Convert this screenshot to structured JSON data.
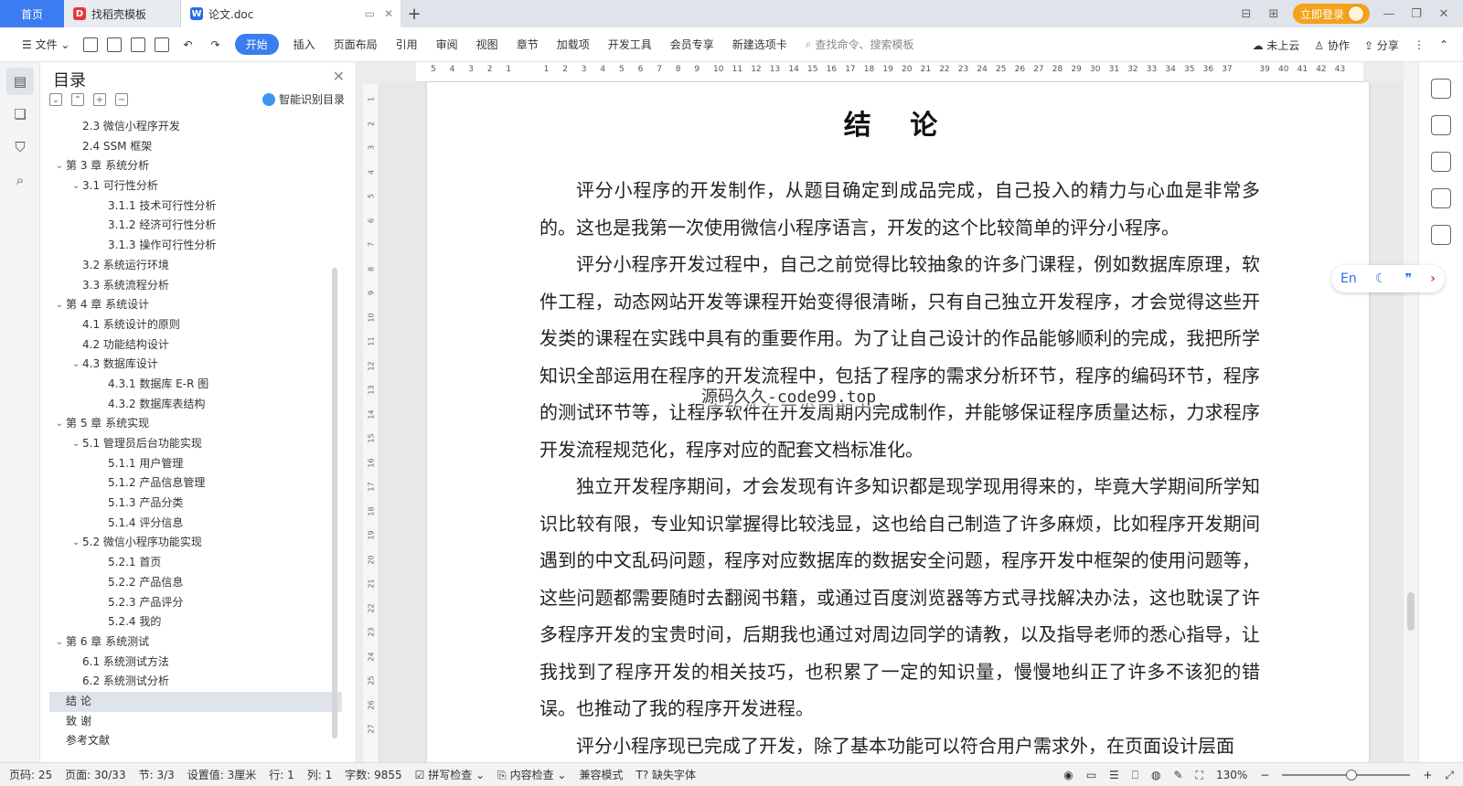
{
  "tabs": {
    "home": "首页",
    "templates": "找稻壳模板",
    "document": "论文.doc"
  },
  "header_right": {
    "login": "立即登录"
  },
  "toolbar": {
    "file": "文件",
    "items": [
      "开始",
      "插入",
      "页面布局",
      "引用",
      "审阅",
      "视图",
      "章节",
      "加载项",
      "开发工具",
      "会员专享",
      "新建选项卡"
    ],
    "search_placeholder": "查找命令、搜索模板",
    "cloud": "未上云",
    "collab": "协作",
    "share": "分享"
  },
  "toc": {
    "title": "目录",
    "smart": "智能识别目录",
    "items": [
      {
        "text": "2.3 微信小程序开发",
        "level": 2,
        "caret": ""
      },
      {
        "text": "2.4 SSM 框架",
        "level": 2,
        "caret": ""
      },
      {
        "text": "第 3 章  系统分析",
        "level": 1,
        "caret": "⌄"
      },
      {
        "text": "3.1 可行性分析",
        "level": 2,
        "caret": "⌄"
      },
      {
        "text": "3.1.1 技术可行性分析",
        "level": 3,
        "caret": ""
      },
      {
        "text": "3.1.2 经济可行性分析",
        "level": 3,
        "caret": ""
      },
      {
        "text": "3.1.3 操作可行性分析",
        "level": 3,
        "caret": ""
      },
      {
        "text": "3.2 系统运行环境",
        "level": 2,
        "caret": ""
      },
      {
        "text": "3.3 系统流程分析",
        "level": 2,
        "caret": ""
      },
      {
        "text": "第 4 章  系统设计",
        "level": 1,
        "caret": "⌄"
      },
      {
        "text": "4.1  系统设计的原则",
        "level": 2,
        "caret": ""
      },
      {
        "text": "4.2  功能结构设计",
        "level": 2,
        "caret": ""
      },
      {
        "text": "4.3  数据库设计",
        "level": 2,
        "caret": "⌄"
      },
      {
        "text": "4.3.1  数据库 E-R 图",
        "level": 3,
        "caret": ""
      },
      {
        "text": "4.3.2  数据库表结构",
        "level": 3,
        "caret": ""
      },
      {
        "text": "第 5 章  系统实现",
        "level": 1,
        "caret": "⌄"
      },
      {
        "text": "5.1 管理员后台功能实现",
        "level": 2,
        "caret": "⌄"
      },
      {
        "text": "5.1.1  用户管理",
        "level": 3,
        "caret": ""
      },
      {
        "text": "5.1.2  产品信息管理",
        "level": 3,
        "caret": ""
      },
      {
        "text": "5.1.3  产品分类",
        "level": 3,
        "caret": ""
      },
      {
        "text": "5.1.4  评分信息",
        "level": 3,
        "caret": ""
      },
      {
        "text": "5.2  微信小程序功能实现",
        "level": 2,
        "caret": "⌄"
      },
      {
        "text": "5.2.1  首页",
        "level": 3,
        "caret": ""
      },
      {
        "text": "5.2.2  产品信息",
        "level": 3,
        "caret": ""
      },
      {
        "text": "5.2.3  产品评分",
        "level": 3,
        "caret": ""
      },
      {
        "text": "5.2.4  我的",
        "level": 3,
        "caret": ""
      },
      {
        "text": "第 6 章  系统测试",
        "level": 1,
        "caret": "⌄"
      },
      {
        "text": "6.1 系统测试方法",
        "level": 2,
        "caret": ""
      },
      {
        "text": "6.2  系统测试分析",
        "level": 2,
        "caret": ""
      },
      {
        "text": "结    论",
        "level": 1,
        "caret": "",
        "selected": true
      },
      {
        "text": "致    谢",
        "level": 1,
        "caret": ""
      },
      {
        "text": "参考文献",
        "level": 1,
        "caret": ""
      }
    ]
  },
  "document": {
    "title": "结  论",
    "paragraphs": [
      "评分小程序的开发制作，从题目确定到成品完成，自己投入的精力与心血是非常多的。这也是我第一次使用微信小程序语言，开发的这个比较简单的评分小程序。",
      "评分小程序开发过程中，自己之前觉得比较抽象的许多门课程，例如数据库原理，软件工程，动态网站开发等课程开始变得很清晰，只有自己独立开发程序，才会觉得这些开发类的课程在实践中具有的重要作用。为了让自己设计的作品能够顺利的完成，我把所学知识全部运用在程序的开发流程中，包括了程序的需求分析环节，程序的编码环节，程序的测试环节等，让程序软件在开发周期内完成制作，并能够保证程序质量达标，力求程序开发流程规范化，程序对应的配套文档标准化。",
      "独立开发程序期间，才会发现有许多知识都是现学现用得来的，毕竟大学期间所学知识比较有限，专业知识掌握得比较浅显，这也给自己制造了许多麻烦，比如程序开发期间遇到的中文乱码问题，程序对应数据库的数据安全问题，程序开发中框架的使用问题等，这些问题都需要随时去翻阅书籍，或通过百度浏览器等方式寻找解决办法，这也耽误了许多程序开发的宝贵时间，后期我也通过对周边同学的请教，以及指导老师的悉心指导，让我找到了程序开发的相关技巧，也积累了一定的知识量，慢慢地纠正了许多不该犯的错误。也推动了我的程序开发进程。",
      "评分小程序现已完成了开发，除了基本功能可以符合用户需求外，在页面设计层面"
    ],
    "watermark": "源码久久-code99.top"
  },
  "translate_widget": {
    "label": "En"
  },
  "statusbar": {
    "page_code": "页码: 25",
    "page": "页面: 30/33",
    "section": "节: 3/3",
    "setting": "设置值: 3厘米",
    "row": "行: 1",
    "col": "列: 1",
    "words": "字数: 9855",
    "spell": "拼写检查",
    "content_check": "内容检查",
    "compat": "兼容模式",
    "missing_font": "缺失字体",
    "zoom": "130%"
  },
  "colors": {
    "accent": "#3b7cf0",
    "login": "#f4a21b",
    "wps_red": "#e53935"
  }
}
